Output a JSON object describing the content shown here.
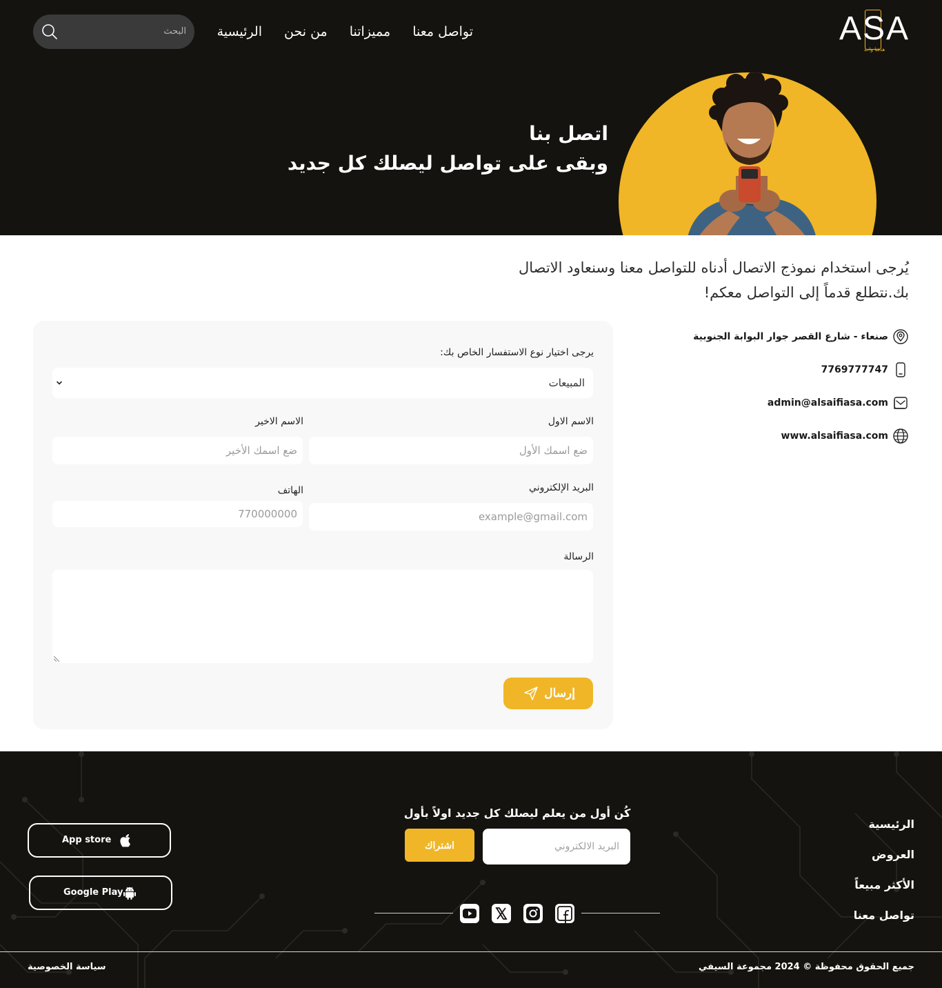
{
  "brand": {
    "logo_text": "ASA",
    "logo_tagline": "هدفنا واحد",
    "accent_color": "#f0b627",
    "dark_color": "#15130f"
  },
  "nav": {
    "items": [
      {
        "label": "الرئيسية"
      },
      {
        "label": "من نحن"
      },
      {
        "label": "مميزاتنا"
      },
      {
        "label": "تواصل معنا"
      }
    ]
  },
  "search": {
    "placeholder": "البحث",
    "icon": "search-icon"
  },
  "hero": {
    "title_line1": "اتصل بنا",
    "title_line2": "وبقى على تواصل ليصلك كل جديد"
  },
  "intro": {
    "text": "يُرجى استخدام نموذج الاتصال أدناه للتواصل معنا وسنعاود الاتصال بك.نتطلع قدماً إلى التواصل معكم!"
  },
  "contact_info": {
    "address": "صنعاء - شارع القصر جوار البوابة الجنوبية",
    "phone": "7769777747",
    "email": "admin@alsaifiasa.com",
    "website": "www.alsaifiasa.com"
  },
  "form": {
    "inquiry_label": "يرجى اختيار نوع الاستفسار الخاص بك:",
    "inquiry_value": "المبيعات",
    "first_name_label": "الاسم الاول",
    "first_name_placeholder": "ضع اسمك الأول",
    "last_name_label": "الاسم الاخير",
    "last_name_placeholder": "ضع اسمك الأخير",
    "email_label": "البريد الإلكتروني",
    "email_placeholder": "example@gmail.com",
    "phone_label": "الهاتف",
    "phone_placeholder": "770000000",
    "message_label": "الرسالة",
    "message_value": "",
    "submit_label": "إرسال"
  },
  "footer": {
    "nav": [
      {
        "label": "الرئيسية"
      },
      {
        "label": "العروض"
      },
      {
        "label": "الأكثر مبيعاً"
      },
      {
        "label": "تواصل معنا"
      }
    ],
    "newsletter_title": "كُن أول من يعلم ليصلك كل جديد اولاً بأول",
    "newsletter_placeholder": "البريد الالكتروني",
    "newsletter_button": "اشتراك",
    "social": [
      "youtube-icon",
      "x-icon",
      "instagram-icon",
      "facebook-icon"
    ],
    "app_store_label": "App store",
    "google_play_label": "Google Play",
    "copyright_text": "جميع الحقوق محفوظة",
    "copyright_symbol": "©",
    "copyright_year": "2024",
    "copyright_owner": "مجموعة السيفي",
    "privacy_label": "سياسة الخصوصية"
  }
}
